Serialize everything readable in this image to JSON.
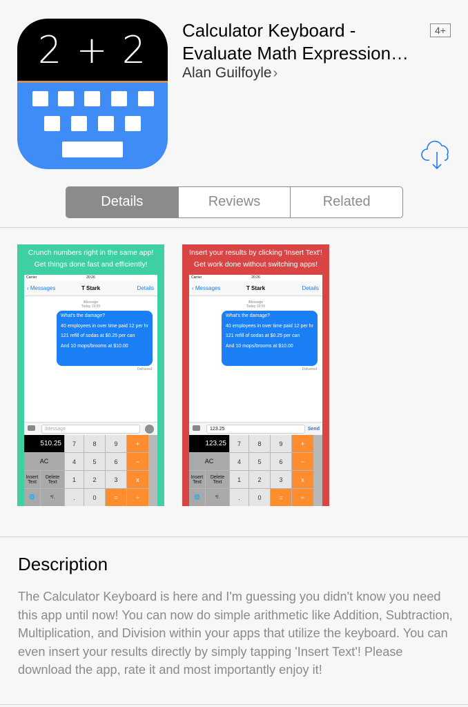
{
  "app": {
    "icon_expression": "2 + 2",
    "title_line1": "Calculator Keyboard -",
    "title_line2": "Evaluate Math Expression…",
    "developer": "Alan Guilfoyle",
    "age_rating": "4+"
  },
  "tabs": [
    {
      "label": "Details",
      "active": true
    },
    {
      "label": "Reviews",
      "active": false
    },
    {
      "label": "Related",
      "active": false
    }
  ],
  "screenshots": [
    {
      "caption_line1": "Crunch numbers right in the same app!",
      "caption_line2": "Get things done fast and efficiently!",
      "bg_color": "#3ecfa3",
      "carrier": "Carrier",
      "time": "20:26",
      "nav_back": "Messages",
      "nav_contact": "T Stark",
      "nav_details": "Details",
      "imessage_label": "iMessage",
      "imessage_time": "Today 19:55",
      "bubble": [
        "What's the damage?",
        "40 employees in over time paid 12 per hr",
        "121 refill of sodas at $0.25 per can",
        "And 10 mops/brooms at $10.00"
      ],
      "delivered": "Delivered",
      "input_text": "iMessage",
      "display": "510.25",
      "keys": [
        "7",
        "8",
        "9",
        "+",
        "AC",
        "4",
        "5",
        "6",
        "−",
        "Insert Text",
        "Delete Text",
        "1",
        "2",
        "3",
        "x",
        "*/.",
        ".",
        "0",
        "=",
        "÷"
      ]
    },
    {
      "caption_line1": "Insert your results by clicking 'Insert Text'!",
      "caption_line2": "Get work done without switching apps!",
      "bg_color": "#d94545",
      "carrier": "Carrier",
      "time": "20:26",
      "nav_back": "Messages",
      "nav_contact": "T Stark",
      "nav_details": "Details",
      "imessage_label": "iMessage",
      "imessage_time": "Today 19:55",
      "bubble": [
        "What's the damage?",
        "40 employees in over time paid 12 per hr",
        "121 refill of sodas at $0.25 per can",
        "And 10 mops/brooms at $10.00"
      ],
      "delivered": "Delivered",
      "input_text": "123.25",
      "send_label": "Send",
      "display": "123.25",
      "keys": [
        "7",
        "8",
        "9",
        "+",
        "AC",
        "4",
        "5",
        "6",
        "−",
        "Insert Text",
        "Delete Text",
        "1",
        "2",
        "3",
        "x",
        "*/.",
        ".",
        "0",
        "=",
        "÷"
      ]
    }
  ],
  "description": {
    "heading": "Description",
    "body": "The Calculator Keyboard is here and I'm guessing you didn't know you need this app until now! You can now do simple arithmetic like Addition, Subtraction, Multiplication, and Division within your apps that utilize the keyboard. You can even insert your results directly by simply tapping 'Insert Text'! Please download the app, rate it and most importantly enjoy it!"
  },
  "colors": {
    "icon_blue": "#3f8cf6",
    "link_blue": "#1a7cf2",
    "segment_gray": "#8b8b8b",
    "operator_orange": "#fd8d2f"
  }
}
